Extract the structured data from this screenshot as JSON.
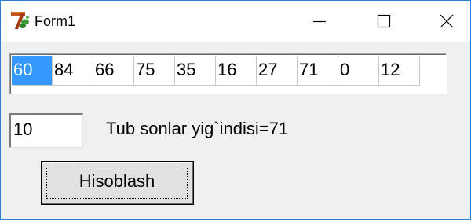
{
  "window": {
    "title": "Form1",
    "controls": {
      "minimize_icon": "minimize-icon",
      "maximize_icon": "maximize-icon",
      "close_icon": "close-icon"
    }
  },
  "grid": {
    "selected_index": 0,
    "cells": [
      "60",
      "84",
      "66",
      "75",
      "35",
      "16",
      "27",
      "71",
      "0",
      "12"
    ]
  },
  "input": {
    "value": "10"
  },
  "result": {
    "text": "Tub sonlar yig`indisi=71"
  },
  "button": {
    "label": "Hisoblash"
  },
  "colors": {
    "selection": "#3399ff",
    "window_border": "#2b7bd1",
    "form_bg": "#f0f0f0"
  }
}
